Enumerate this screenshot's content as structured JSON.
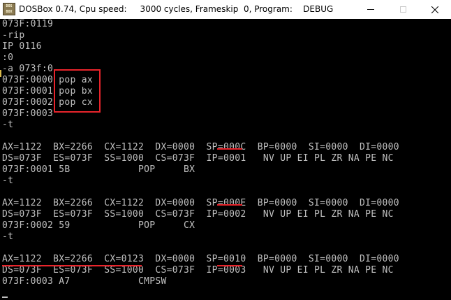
{
  "window": {
    "title": "DOSBox 0.74, Cpu speed:     3000 cycles, Frameskip  0, Program:    DEBUG",
    "icon_label": "DOS\nBOX",
    "icons": {
      "app": "dosbox-app-icon",
      "minimize": "minimize-icon",
      "maximize": "maximize-icon",
      "close": "close-icon"
    }
  },
  "console": {
    "lines": [
      "073F:0119",
      "-rip",
      "IP 0116",
      ":0",
      "-a 073f:0",
      "073F:0000 pop ax",
      "073F:0001 pop bx",
      "073F:0002 pop cx",
      "073F:0003",
      "-t",
      "",
      "AX=1122  BX=2266  CX=1122  DX=0000  SP=000C  BP=0000  SI=0000  DI=0000",
      "DS=073F  ES=073F  SS=1000  CS=073F  IP=0001   NV UP EI PL ZR NA PE NC",
      "073F:0001 5B            POP     BX",
      "-t",
      "",
      "AX=1122  BX=2266  CX=1122  DX=0000  SP=000E  BP=0000  SI=0000  DI=0000",
      "DS=073F  ES=073F  SS=1000  CS=073F  IP=0002   NV UP EI PL ZR NA PE NC",
      "073F:0002 59            POP     CX",
      "-t",
      "",
      "AX=1122  BX=2266  CX=0123  DX=0000  SP=0010  BP=0000  SI=0000  DI=0000",
      "DS=073F  ES=073F  SS=1000  CS=073F  IP=0003   NV UP EI PL ZR NA PE NC",
      "073F:0003 A7            CMPSW"
    ]
  },
  "colors": {
    "console_bg": "#000000",
    "console_text": "#c0c0c0",
    "annotation_red": "#e8242b",
    "titlebar_bg": "#ffffff"
  }
}
